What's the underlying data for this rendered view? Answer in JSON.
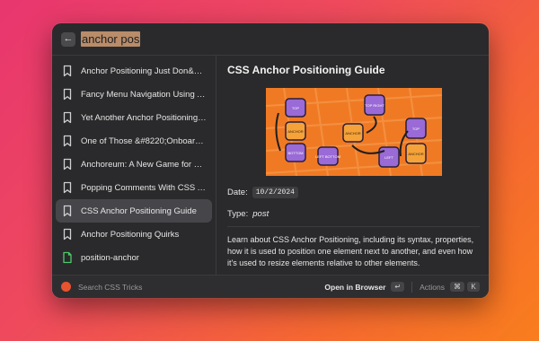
{
  "search": {
    "query": "anchor pos"
  },
  "results": [
    {
      "label": "Anchor Positioning Just Don&#…",
      "icon": "bookmark-icon",
      "selected": false
    },
    {
      "label": "Fancy Menu Navigation Using A…",
      "icon": "bookmark-icon",
      "selected": false
    },
    {
      "label": "Yet Another Anchor Positioning…",
      "icon": "bookmark-icon",
      "selected": false
    },
    {
      "label": "One of Those &#8220;Onboardi…",
      "icon": "bookmark-icon",
      "selected": false
    },
    {
      "label": "Anchoreum: A New Game for Le…",
      "icon": "bookmark-icon",
      "selected": false
    },
    {
      "label": "Popping Comments With CSS A…",
      "icon": "bookmark-icon",
      "selected": false
    },
    {
      "label": "CSS Anchor Positioning Guide",
      "icon": "bookmark-icon",
      "selected": true
    },
    {
      "label": "Anchor Positioning Quirks",
      "icon": "bookmark-icon",
      "selected": false
    },
    {
      "label": "position-anchor",
      "icon": "document-icon",
      "selected": false
    }
  ],
  "detail": {
    "title": "CSS Anchor Positioning Guide",
    "date_label": "Date:",
    "date_value": "10/2/2024",
    "type_label": "Type:",
    "type_value": "post",
    "description": "Learn about CSS Anchor Positioning, including its syntax, properties, how it is used to position one element next to another, and even how it's used to resize elements relative to other elements.",
    "hero_labels": [
      "TOP",
      "ANCHOR",
      "BOTTOM",
      "TOP RIGHT",
      "ANCHOR",
      "LEFT BOTTOM",
      "TOP",
      "LEFT",
      "ANCHOR"
    ]
  },
  "footer": {
    "search_label": "Search CSS Tricks",
    "primary_action": "Open in Browser",
    "primary_key": "↵",
    "actions_label": "Actions",
    "actions_keys": [
      "⌘",
      "K"
    ]
  },
  "colors": {
    "bg_start": "#e8366f",
    "bg_end": "#f97e1d",
    "window": "#2a2a2c",
    "selected": "#46464a",
    "hero_orange": "#f07a24",
    "hero_purple": "#9a6ad6"
  }
}
